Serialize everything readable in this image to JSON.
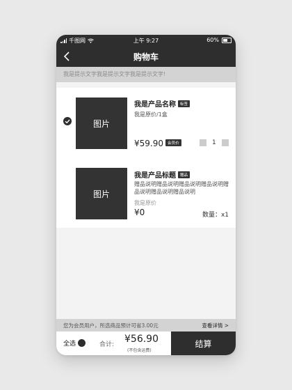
{
  "status_bar": {
    "carrier": "千图网",
    "time": "上午 9:27",
    "battery": "60%"
  },
  "nav": {
    "title": "购物车"
  },
  "tip": "我是提示文字我是提示文字我是提示文字!",
  "cart_items": [
    {
      "checked": true,
      "image_label": "图片",
      "name": "我是产品名称",
      "tag": "标签",
      "original": "我是原价/1盒",
      "price": "¥59.90",
      "member_tag": "会员价",
      "quantity": "1"
    },
    {
      "image_label": "图片",
      "name": "我是产品标题",
      "tag": "赠品",
      "description": "赠品说明赠品说明赠品说明赠品说明赠品说明赠品说明赠品说明",
      "original": "我是原价",
      "price": "¥0",
      "quantity_text": "数量：x1"
    }
  ],
  "member_bar": {
    "text": "您为会员用户，所选商品预计可省3.00元",
    "detail": "查看详情 >"
  },
  "bottom": {
    "select_all": "全选",
    "total_label": "合计:",
    "total": "¥56.90",
    "note": "(不包含运费)",
    "checkout": "结算"
  },
  "colors": {
    "dark": "#2e2e2e",
    "tip_bg": "#d3d3d3",
    "page_bg": "#e9e9e9"
  }
}
